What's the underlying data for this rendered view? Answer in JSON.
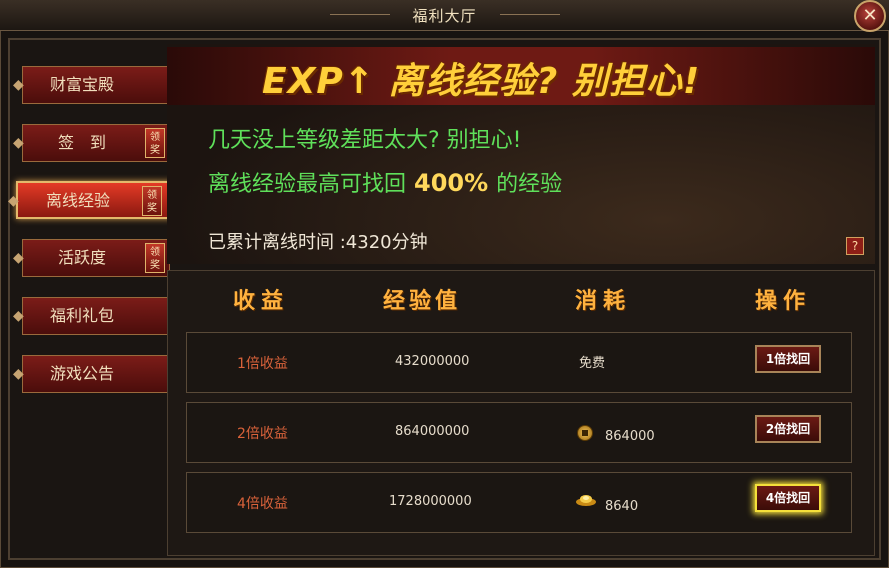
{
  "window": {
    "title": "福利大厅",
    "close_symbol": "✕"
  },
  "sidebar": {
    "items": [
      {
        "label": "财富宝殿",
        "badge": ""
      },
      {
        "label": "签　到",
        "badge": "领奖"
      },
      {
        "label": "离线经验",
        "badge": "领奖",
        "active": true
      },
      {
        "label": "活跃度",
        "badge": "领奖"
      },
      {
        "label": "福利礼包",
        "badge": ""
      },
      {
        "label": "游戏公告",
        "badge": ""
      }
    ]
  },
  "banner": {
    "headline": "EXP↑ 离线经验? 别担心!",
    "line1": "几天没上等级差距太大? 别担心!",
    "line2_prefix": "离线经验最高可找回",
    "line2_percent": "400%",
    "line2_suffix": "的经验",
    "offline_time": "已累计离线时间 :4320分钟",
    "help": "?"
  },
  "table": {
    "headers": [
      "收益",
      "经验值",
      "消耗",
      "操作"
    ],
    "rows": [
      {
        "gain": "1倍收益",
        "exp": "432000000",
        "cost": "免费",
        "cost_icon": "",
        "button": "1倍找回"
      },
      {
        "gain": "2倍收益",
        "exp": "864000000",
        "cost": "864000",
        "cost_icon": "coin-icon",
        "button": "2倍找回"
      },
      {
        "gain": "4倍收益",
        "exp": "1728000000",
        "cost": "8640",
        "cost_icon": "gold-ingot-icon",
        "button": "4倍找回"
      }
    ]
  },
  "colors": {
    "accent_gold": "#ffcf3a",
    "green_text": "#5fe05a",
    "gain_text": "#d9623a"
  }
}
